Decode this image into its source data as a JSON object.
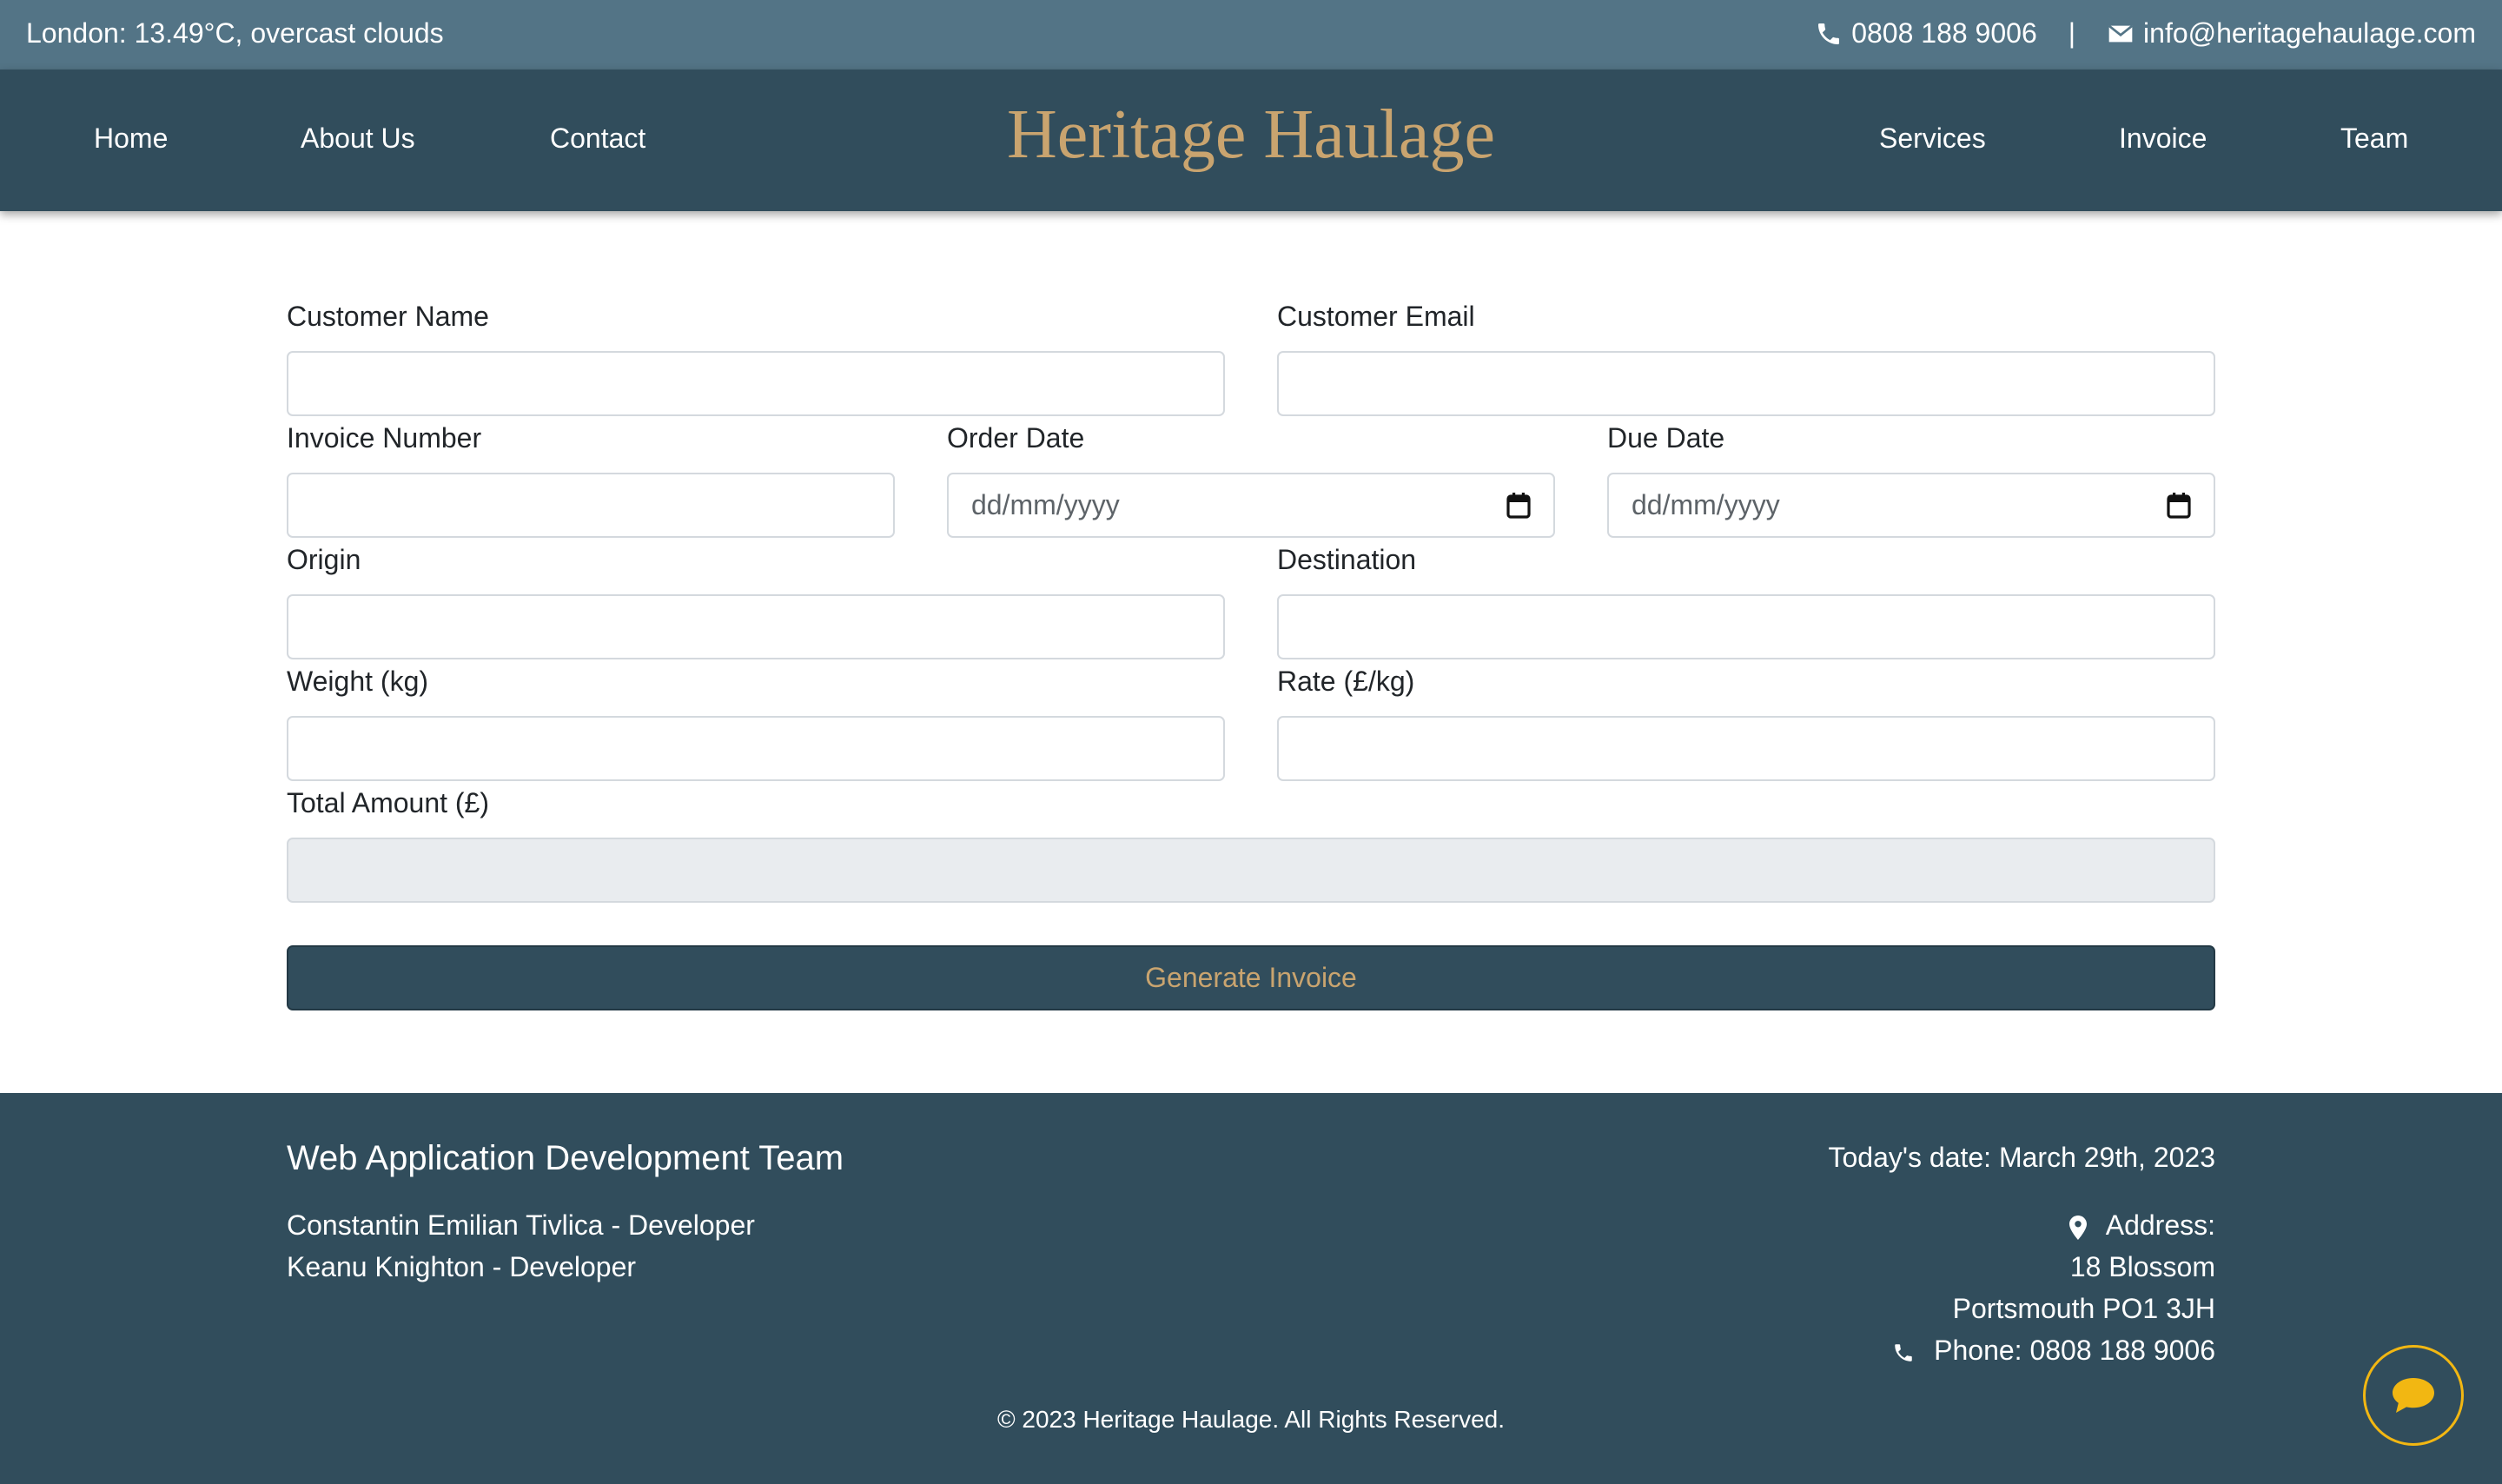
{
  "topbar": {
    "weather": "London: 13.49°C, overcast clouds",
    "phone": "0808 188 9006",
    "separator": "|",
    "email": "info@heritagehaulage.com"
  },
  "nav": {
    "brand": "Heritage Haulage",
    "left": [
      "Home",
      "About Us",
      "Contact"
    ],
    "right": [
      "Services",
      "Invoice",
      "Team"
    ]
  },
  "form": {
    "customer_name": {
      "label": "Customer Name",
      "value": ""
    },
    "customer_email": {
      "label": "Customer Email",
      "value": ""
    },
    "invoice_number": {
      "label": "Invoice Number",
      "value": ""
    },
    "order_date": {
      "label": "Order Date",
      "placeholder": "dd/mm/yyyy"
    },
    "due_date": {
      "label": "Due Date",
      "placeholder": "dd/mm/yyyy"
    },
    "origin": {
      "label": "Origin",
      "value": ""
    },
    "destination": {
      "label": "Destination",
      "value": ""
    },
    "weight": {
      "label": "Weight (kg)",
      "value": ""
    },
    "rate": {
      "label": "Rate (£/kg)",
      "value": ""
    },
    "total": {
      "label": "Total Amount (£)",
      "value": ""
    },
    "submit_label": "Generate Invoice"
  },
  "footer": {
    "team_title": "Web Application Development Team",
    "developers": [
      "Constantin Emilian Tivlica - Developer",
      "Keanu Knighton - Developer"
    ],
    "date": "Today's date: March 29th, 2023",
    "address_label": "Address:",
    "address_line1": "18 Blossom",
    "address_line2": "Portsmouth PO1 3JH",
    "phone": "Phone: 0808 188 9006",
    "copyright": "© 2023 Heritage Haulage. All Rights Reserved."
  },
  "icons": {
    "phone": "phone-icon",
    "email": "envelope-icon",
    "calendar": "calendar-icon",
    "address": "map-marker-icon",
    "chat": "chat-bubble-icon"
  },
  "colors": {
    "topbar": "#537486",
    "navbar": "#314d5c",
    "brand_gold": "#c9a46f",
    "chat_ring": "#f2b712"
  }
}
